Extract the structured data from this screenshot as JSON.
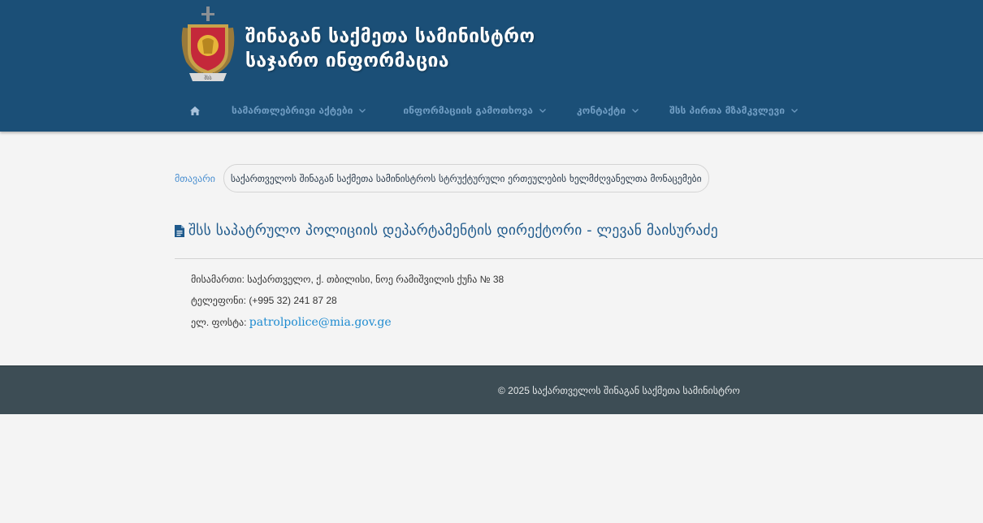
{
  "header": {
    "title_line1": "შინაგან საქმეთა სამინისტრო",
    "title_line2": "საჯარო ინფორმაცია"
  },
  "nav": {
    "home_icon": "home-icon",
    "items": [
      {
        "label": "სამართლებრივი აქტები"
      },
      {
        "label": "ინფორმაციის გამოთხოვა"
      },
      {
        "label": "კონტაქტი"
      },
      {
        "label": "შსს პირთა მზამკვლევი"
      }
    ]
  },
  "breadcrumb": {
    "home": "მთავარი",
    "current": "საქართველოს შინაგან საქმეთა სამინისტროს სტრუქტურული ერთეულების ხელმძღვანელთა მონაცემები"
  },
  "page": {
    "title": "შსს საპატრულო პოლიციის დეპარტამენტის დირექტორი - ლევან მაისურაძე"
  },
  "contact": {
    "address_label": "მისამართი:",
    "address_value": "საქართველო, ქ. თბილისი, ნოე რამიშვილის ქუჩა № 38",
    "phone_label": "ტელეფონი:",
    "phone_value": "(+995 32) 241 87 28",
    "email_label": "ელ. ფოსტა:",
    "email_value": "patrolpolice@mia.gov.ge"
  },
  "footer": {
    "copyright": "© 2025 საქართველოს შინაგან საქმეთა სამინისტრო"
  },
  "colors": {
    "header_bg": "#1b4f77",
    "nav_text": "#6f9cc2",
    "link": "#1e8bd0",
    "heading": "#1f5a8c",
    "footer_bg": "#3d4d55",
    "page_bg": "#f4f4f4"
  }
}
